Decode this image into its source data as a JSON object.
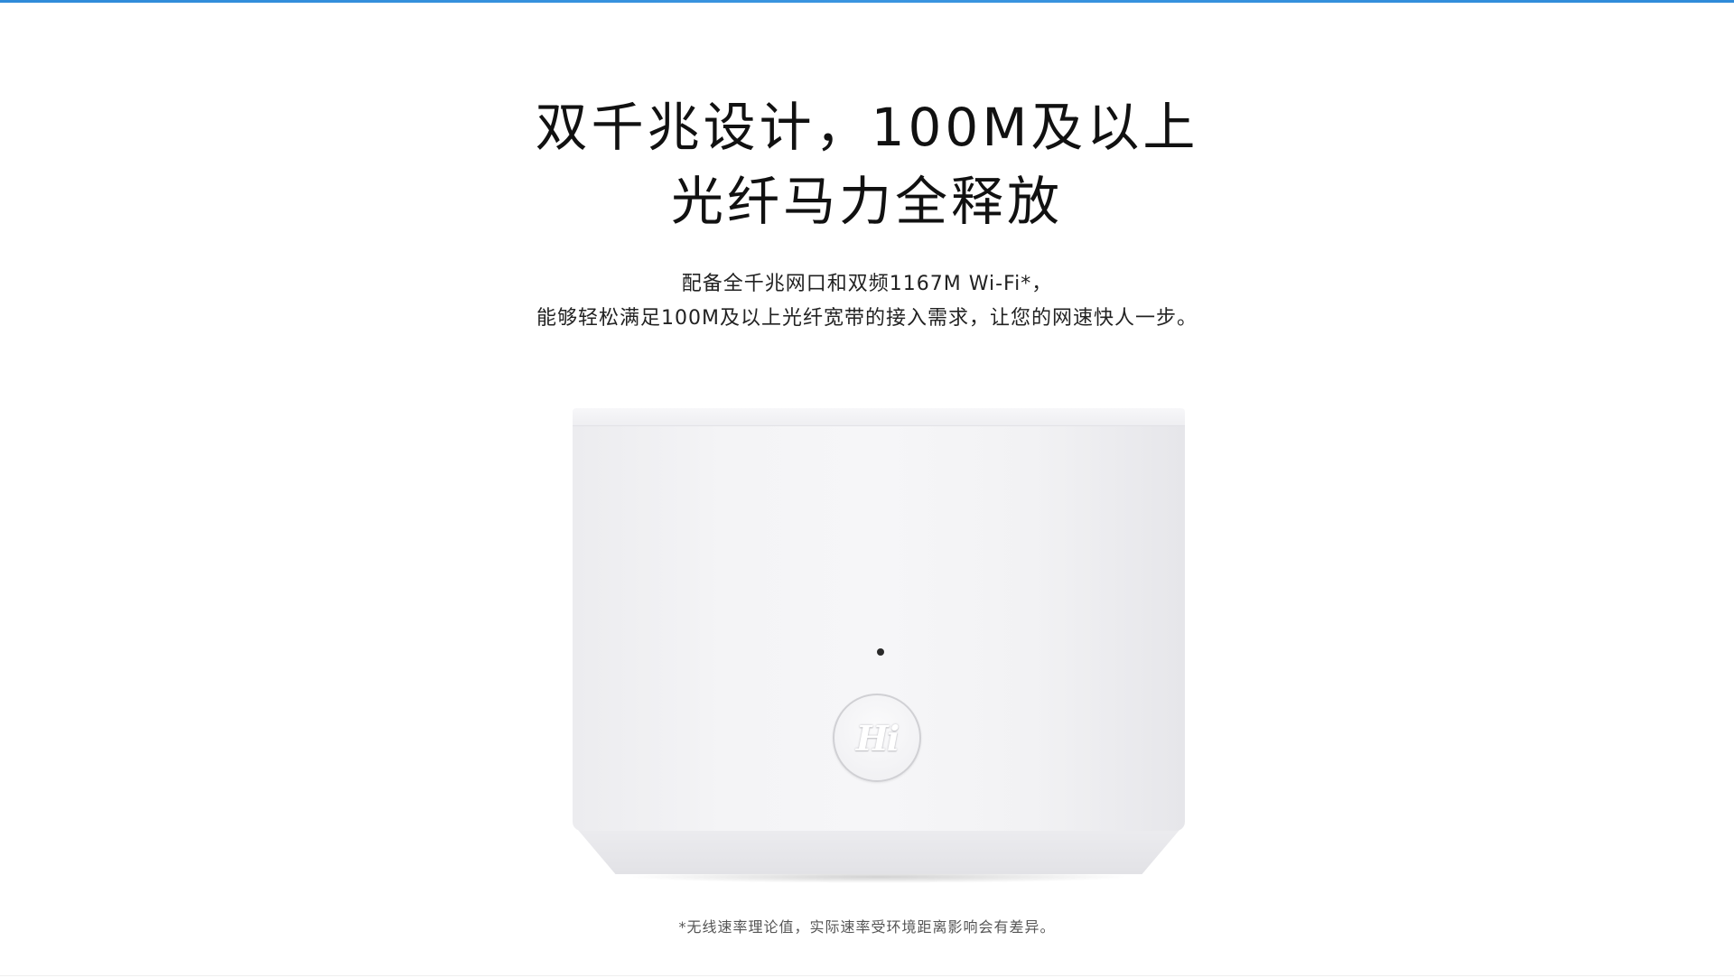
{
  "headline": {
    "line1": "双千兆设计，100M及以上",
    "line2": "光纤马力全释放"
  },
  "description": {
    "line1": "配备全千兆网口和双频1167M Wi-Fi*，",
    "line2": "能够轻松满足100M及以上光纤宽带的接入需求，让您的网速快人一步。"
  },
  "product": {
    "button_logo": "Hi"
  },
  "footnote": "*无线速率理论值，实际速率受环境距离影响会有差异。",
  "colors": {
    "accent": "#2f8bd9",
    "headline": "#111111",
    "body_text": "#222222",
    "footnote": "#555555",
    "background": "#ffffff",
    "router_body": "#f4f4f6"
  }
}
